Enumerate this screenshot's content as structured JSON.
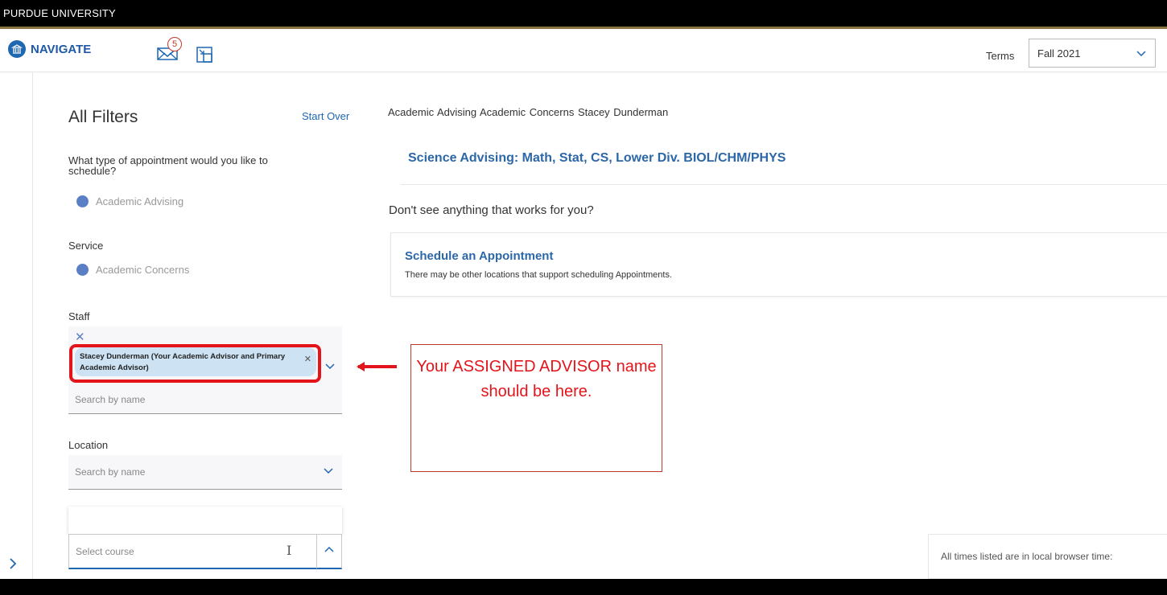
{
  "topbar": {
    "brand": "PURDUE UNIVERSITY"
  },
  "navbar": {
    "logo_text": "NAVIGATE",
    "mail_count": "5",
    "terms_label": "Terms",
    "terms_value": "Fall 2021"
  },
  "filters": {
    "title": "All Filters",
    "start_over": "Start Over",
    "appointment_question": "What type of appointment would you like to schedule?",
    "appointment_value": "Academic Advising",
    "service_label": "Service",
    "service_value": "Academic Concerns",
    "staff_label": "Staff",
    "staff_chip": "Stacey Dunderman (Your Academic Advisor and Primary Academic Advisor)",
    "staff_placeholder": "Search by name",
    "location_label": "Location",
    "location_placeholder": "Search by name",
    "course_placeholder": "Select course"
  },
  "main": {
    "breadcrumb": "Academic Advising  Academic Concerns  Stacey Dunderman",
    "result_title": "Science Advising: Math, Stat, CS, Lower Div. BIOL/CHM/PHYS",
    "dont_see": "Don't see anything that works for you?",
    "schedule_title": "Schedule an Appointment",
    "schedule_subtitle": "There may be other locations that support scheduling Appointments.",
    "times_note": "All times listed are in local browser time:"
  },
  "annotation": {
    "callout_text": "Your ASSIGNED ADVISOR name should be here."
  },
  "colors": {
    "accent_blue": "#2c67a8",
    "annotation_red": "#e4141b",
    "gold_stripe": "#8a7340"
  },
  "icons": [
    "mail-icon",
    "layout-switch-icon",
    "chevron-down-icon",
    "chevron-up-icon",
    "chevron-right-icon",
    "close-icon",
    "text-cursor-icon",
    "left-arrow-icon"
  ]
}
